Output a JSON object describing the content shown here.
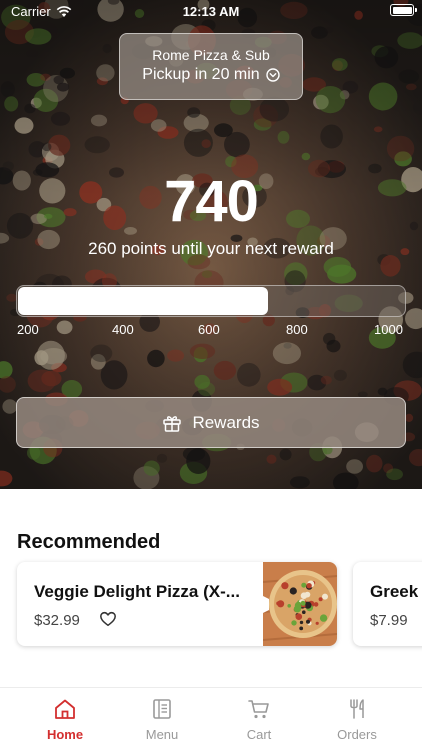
{
  "status_bar": {
    "carrier": "Carrier",
    "time": "12:13 AM",
    "icons": [
      "wifi-icon",
      "battery-icon"
    ]
  },
  "store": {
    "name": "Rome Pizza & Sub",
    "pickup": "Pickup in 20 min",
    "icon": "chevron-down-circle-icon"
  },
  "rewards": {
    "points": "740",
    "subtitle": "260 points until your next reward",
    "progress_value": 740,
    "progress_min": 200,
    "progress_max": 1000,
    "ticks": [
      "200",
      "400",
      "600",
      "800",
      "1000"
    ],
    "button_label": "Rewards",
    "button_icon": "gift-icon"
  },
  "recommended": {
    "title": "Recommended",
    "items": [
      {
        "name": "Veggie Delight Pizza (X-...",
        "price": "$32.99",
        "icon": "heart-icon"
      },
      {
        "name": "Greek",
        "price": "$7.99"
      }
    ]
  },
  "tabbar": {
    "accent": "#d32f2f",
    "inactive": "#999999",
    "tabs": [
      {
        "label": "Home",
        "icon": "home-icon",
        "active": true
      },
      {
        "label": "Menu",
        "icon": "menu-icon",
        "active": false
      },
      {
        "label": "Cart",
        "icon": "cart-icon",
        "active": false
      },
      {
        "label": "Orders",
        "icon": "utensils-icon",
        "active": false
      }
    ]
  }
}
